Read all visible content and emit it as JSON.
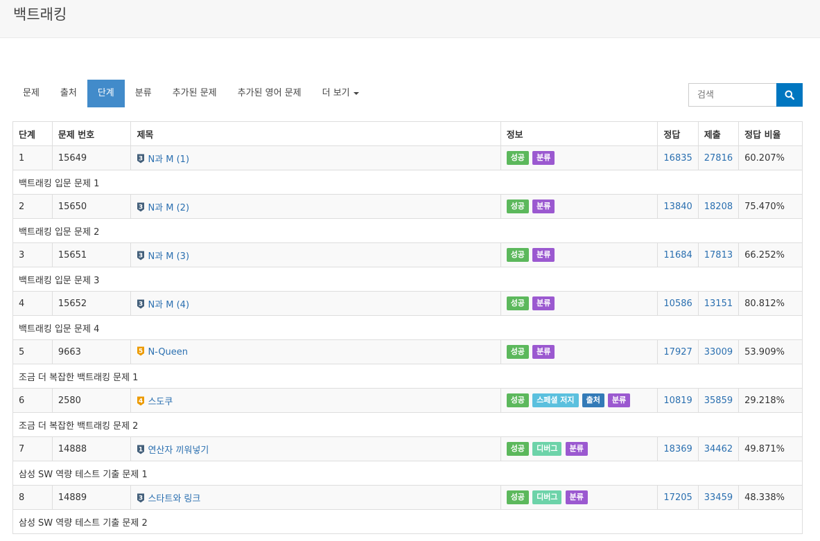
{
  "header": {
    "title": "백트래킹"
  },
  "nav": {
    "tabs": [
      "문제",
      "출처",
      "단계",
      "분류",
      "추가된 문제",
      "추가된 영어 문제",
      "더 보기"
    ],
    "active_index": 2
  },
  "search": {
    "placeholder": "검색"
  },
  "table": {
    "headers": [
      "단계",
      "문제 번호",
      "제목",
      "정보",
      "정답",
      "제출",
      "정답 비율"
    ],
    "rows": [
      {
        "step": "1",
        "id": "15649",
        "tier": "3",
        "tier_color": "#435f7a",
        "title": "N과 M (1)",
        "labels": [
          {
            "text": "성공",
            "cls": "lbl-success"
          },
          {
            "text": "분류",
            "cls": "lbl-algo"
          }
        ],
        "accepted": "16835",
        "submissions": "27816",
        "ratio": "60.207%",
        "desc": "백트래킹 입문 문제 1"
      },
      {
        "step": "2",
        "id": "15650",
        "tier": "3",
        "tier_color": "#435f7a",
        "title": "N과 M (2)",
        "labels": [
          {
            "text": "성공",
            "cls": "lbl-success"
          },
          {
            "text": "분류",
            "cls": "lbl-algo"
          }
        ],
        "accepted": "13840",
        "submissions": "18208",
        "ratio": "75.470%",
        "desc": "백트래킹 입문 문제 2"
      },
      {
        "step": "3",
        "id": "15651",
        "tier": "3",
        "tier_color": "#435f7a",
        "title": "N과 M (3)",
        "labels": [
          {
            "text": "성공",
            "cls": "lbl-success"
          },
          {
            "text": "분류",
            "cls": "lbl-algo"
          }
        ],
        "accepted": "11684",
        "submissions": "17813",
        "ratio": "66.252%",
        "desc": "백트래킹 입문 문제 3"
      },
      {
        "step": "4",
        "id": "15652",
        "tier": "3",
        "tier_color": "#435f7a",
        "title": "N과 M (4)",
        "labels": [
          {
            "text": "성공",
            "cls": "lbl-success"
          },
          {
            "text": "분류",
            "cls": "lbl-algo"
          }
        ],
        "accepted": "10586",
        "submissions": "13151",
        "ratio": "80.812%",
        "desc": "백트래킹 입문 문제 4"
      },
      {
        "step": "5",
        "id": "9663",
        "tier": "5",
        "tier_color": "#ec9a00",
        "title": "N-Queen",
        "labels": [
          {
            "text": "성공",
            "cls": "lbl-success"
          },
          {
            "text": "분류",
            "cls": "lbl-algo"
          }
        ],
        "accepted": "17927",
        "submissions": "33009",
        "ratio": "53.909%",
        "desc": "조금 더 복잡한 백트래킹 문제 1"
      },
      {
        "step": "6",
        "id": "2580",
        "tier": "4",
        "tier_color": "#ec9a00",
        "title": "스도쿠",
        "labels": [
          {
            "text": "성공",
            "cls": "lbl-success"
          },
          {
            "text": "스페셜 저지",
            "cls": "lbl-special"
          },
          {
            "text": "출처",
            "cls": "lbl-source"
          },
          {
            "text": "분류",
            "cls": "lbl-algo"
          }
        ],
        "accepted": "10819",
        "submissions": "35859",
        "ratio": "29.218%",
        "desc": "조금 더 복잡한 백트래킹 문제 2"
      },
      {
        "step": "7",
        "id": "14888",
        "tier": "1",
        "tier_color": "#435f7a",
        "title": "연산자 끼워넣기",
        "labels": [
          {
            "text": "성공",
            "cls": "lbl-success"
          },
          {
            "text": "디버그",
            "cls": "lbl-debug"
          },
          {
            "text": "분류",
            "cls": "lbl-algo"
          }
        ],
        "accepted": "18369",
        "submissions": "34462",
        "ratio": "49.871%",
        "desc": "삼성 SW 역량 테스트 기출 문제 1"
      },
      {
        "step": "8",
        "id": "14889",
        "tier": "3",
        "tier_color": "#435f7a",
        "title": "스타트와 링크",
        "labels": [
          {
            "text": "성공",
            "cls": "lbl-success"
          },
          {
            "text": "디버그",
            "cls": "lbl-debug"
          },
          {
            "text": "분류",
            "cls": "lbl-algo"
          }
        ],
        "accepted": "17205",
        "submissions": "33459",
        "ratio": "48.338%",
        "desc": "삼성 SW 역량 테스트 기출 문제 2"
      }
    ]
  }
}
